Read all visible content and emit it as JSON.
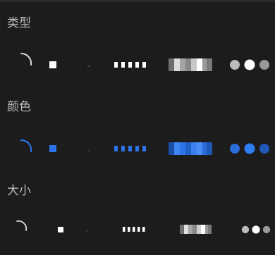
{
  "sections": [
    {
      "label": "类型",
      "tone": "neutral",
      "options": [
        "spinner-arc",
        "square",
        "dots-fading",
        "dashes",
        "gradient-bars",
        "three-dots"
      ]
    },
    {
      "label": "颜色",
      "tone": "accent",
      "options": [
        "spinner-arc",
        "square",
        "dots-fading",
        "dashes",
        "gradient-bars",
        "three-dots"
      ]
    },
    {
      "label": "大小",
      "tone": "neutral",
      "options": [
        "spinner-arc",
        "square",
        "dots-fading",
        "dashes",
        "gradient-bars",
        "three-dots"
      ]
    }
  ],
  "colors": {
    "background": "#1c1c1c",
    "label": "#bdbdbd",
    "neutral_light": "#ffffff",
    "neutral_mid": "#bbbbbb",
    "neutral_dark": "#6e6e6e",
    "accent": "#2a73e8",
    "accent_light": "#4a8ef5",
    "accent_dark": "#1a4fa8"
  }
}
